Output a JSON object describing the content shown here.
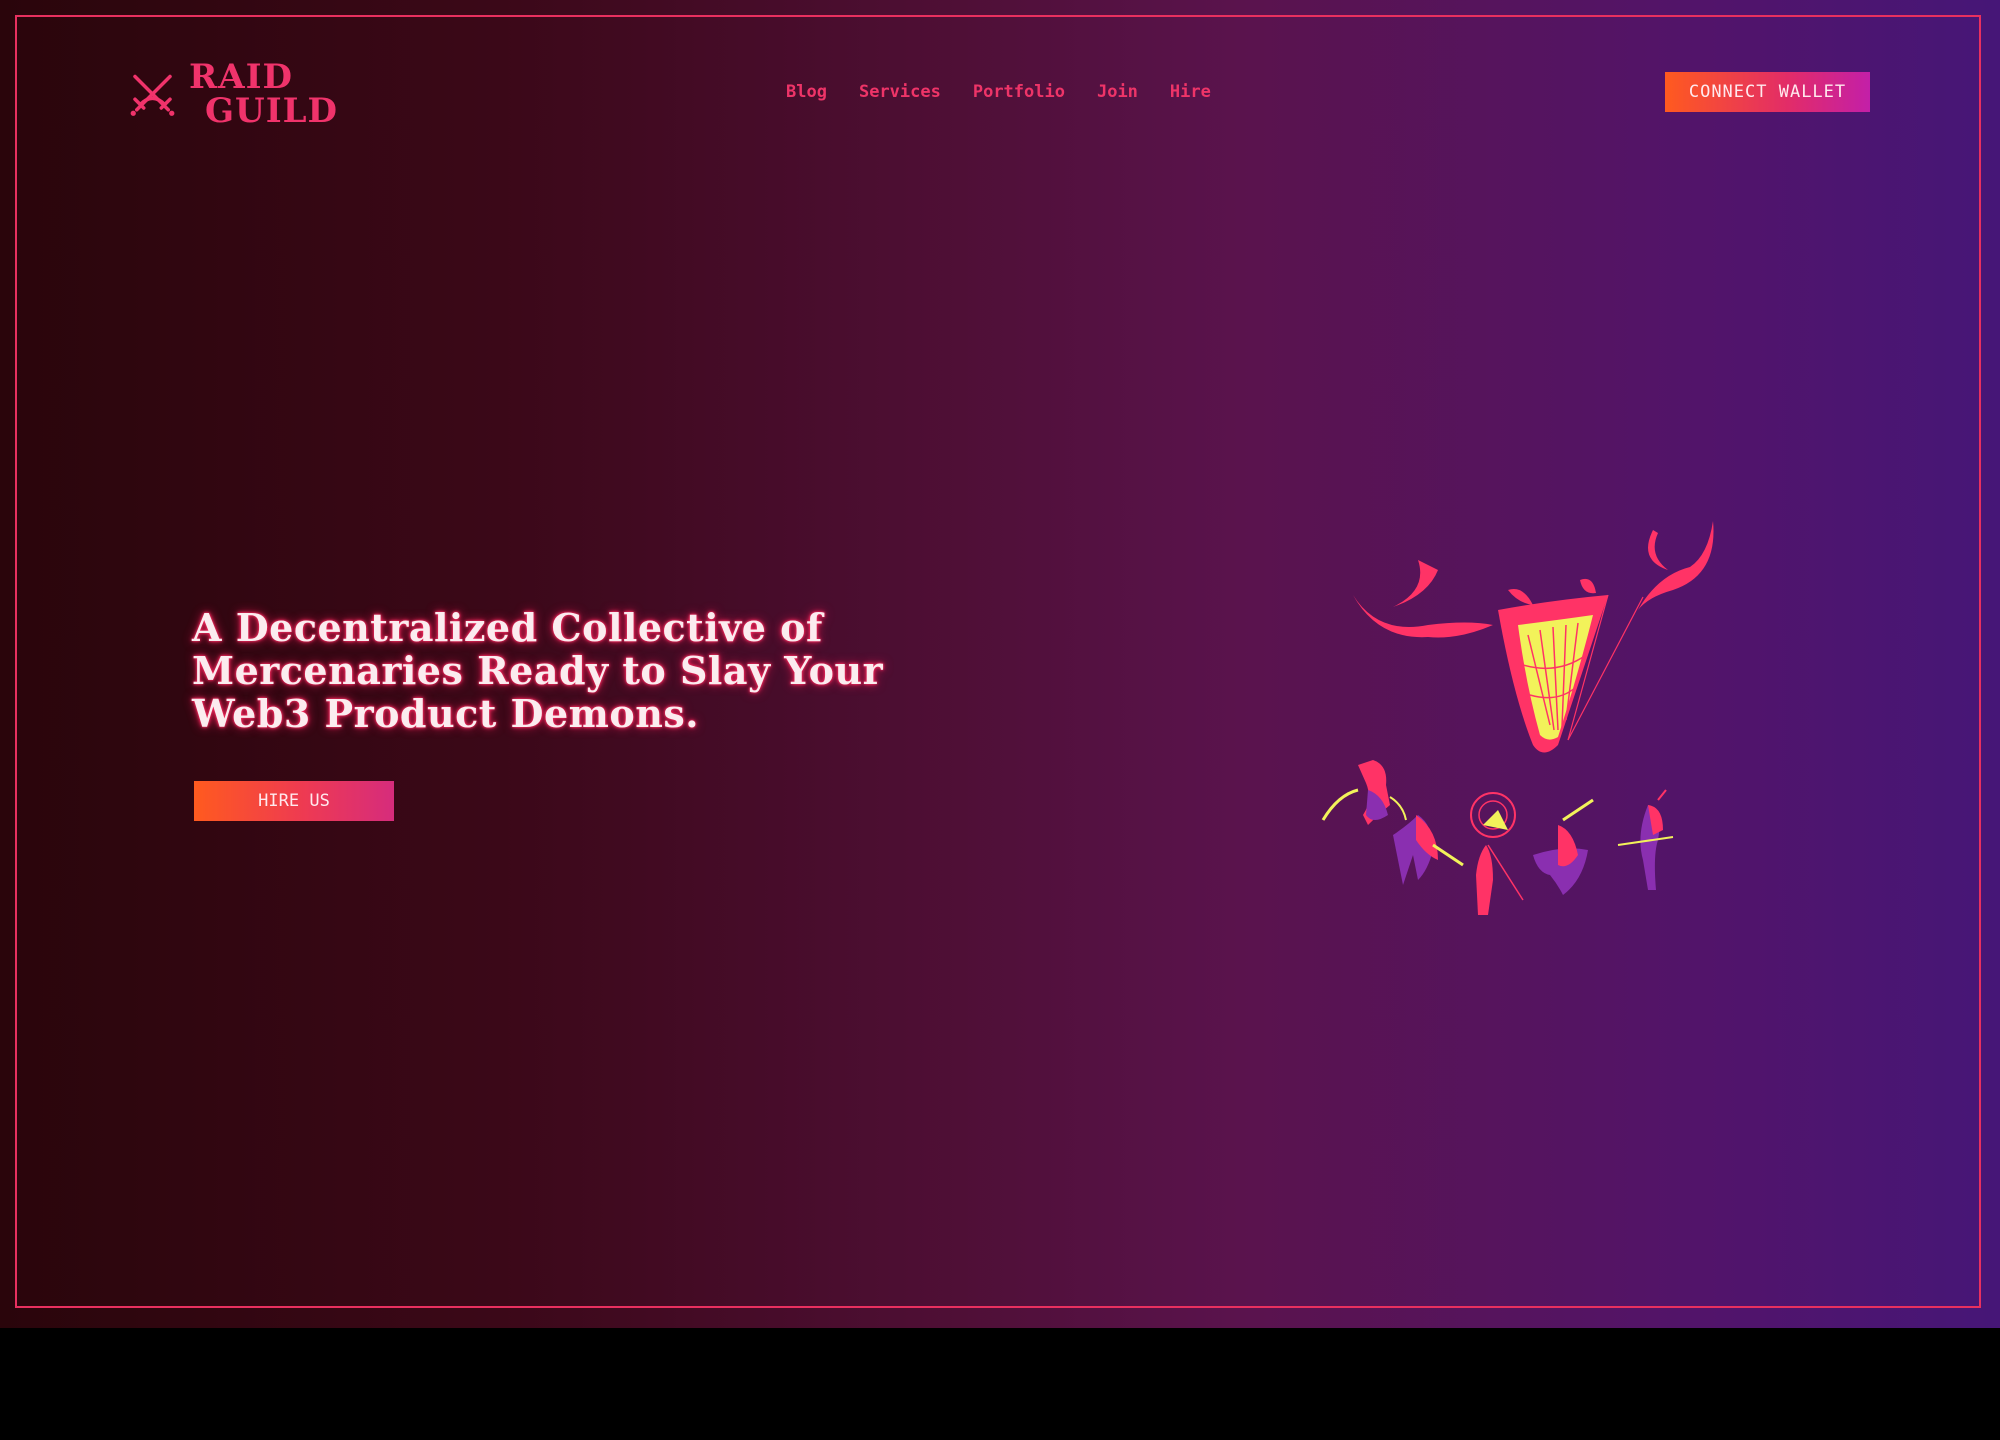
{
  "brand": {
    "name_line1": "RAID",
    "name_line2": "GUILD",
    "logo_icon": "crossed-swords-icon"
  },
  "nav": {
    "items": [
      {
        "label": "Blog"
      },
      {
        "label": "Services"
      },
      {
        "label": "Portfolio"
      },
      {
        "label": "Join"
      },
      {
        "label": "Hire"
      }
    ]
  },
  "header": {
    "connect_label": "CONNECT WALLET"
  },
  "hero": {
    "title": "A Decentralized Collective of Mercenaries Ready to Slay Your Web3 Product Demons.",
    "cta_label": "HIRE US",
    "illustration_icon": "demon-and-raiders-illustration"
  },
  "colors": {
    "accent": "#f0336b",
    "button_start": "#ff5a1f",
    "button_end": "#c31fa8",
    "frame": "#e8305f",
    "illustration_pink": "#ff3366",
    "illustration_purple": "#8a2fb0",
    "illustration_yellow": "#f2f25a"
  }
}
